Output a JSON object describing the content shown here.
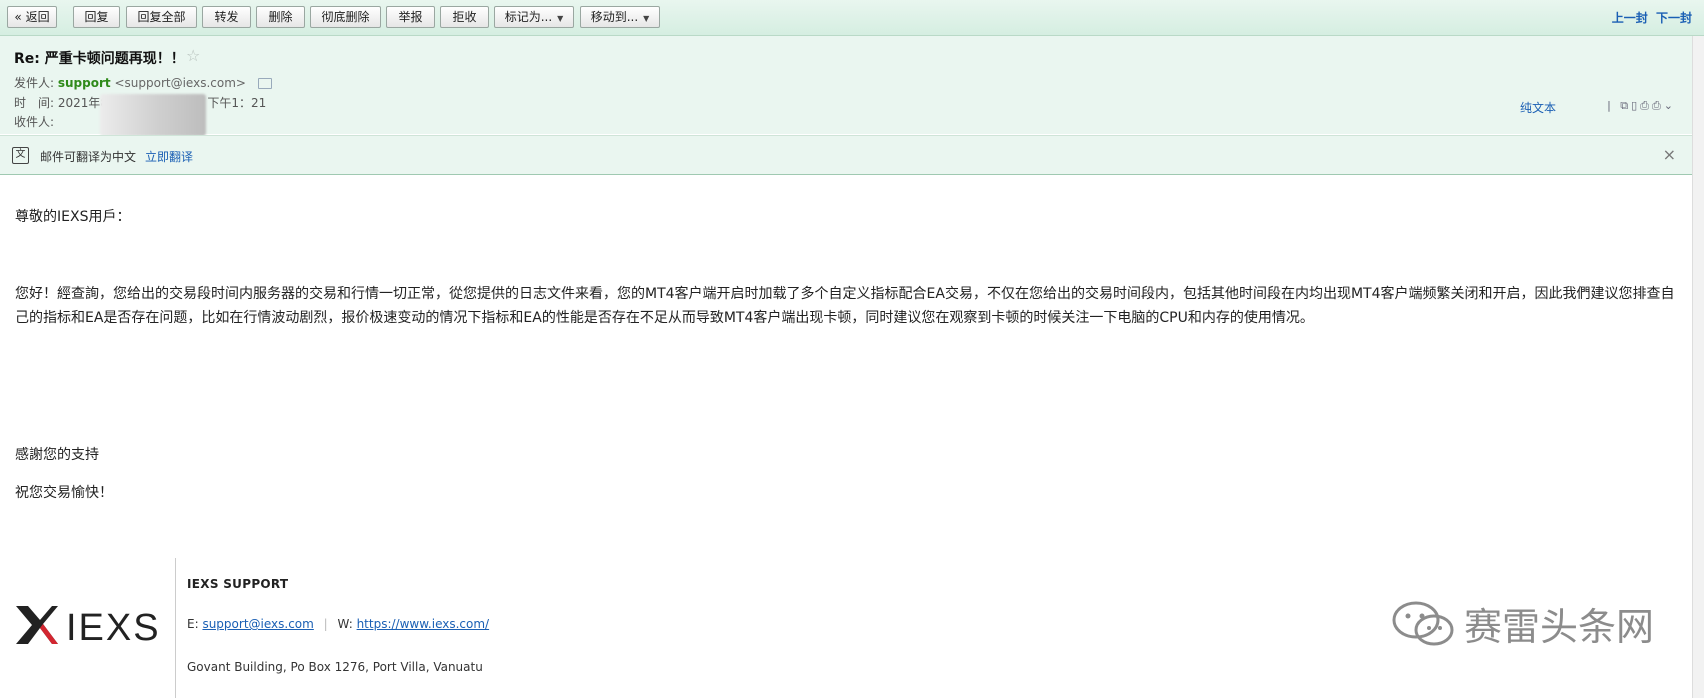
{
  "toolbar": {
    "back": "« 返回",
    "reply": "回复",
    "reply_all": "回复全部",
    "forward": "转发",
    "delete": "删除",
    "delete_forever": "彻底删除",
    "report": "举报",
    "reject": "拒收",
    "mark_as": "标记为...",
    "move_to": "移动到...",
    "prev": "上一封",
    "next": "下一封"
  },
  "header": {
    "subject": "Re: 严重卡顿问题再现！！",
    "sender_label": "发件人:",
    "sender_name": "support",
    "sender_email": "<support@iexs.com>",
    "time_label": "时　间:",
    "time_value": "2021年8月12日（星期四）下午1：21",
    "recipient_label": "收件人:",
    "plain_text": "纯文本",
    "star_icon": "star-icon"
  },
  "translate": {
    "notice": "邮件可翻译为中文",
    "action": "立即翻译"
  },
  "body": {
    "greeting": "尊敬的IEXS用戶：",
    "paragraph": "您好！經查詢，您给出的交易段时间内服务器的交易和行情一切正常，從您提供的日志文件来看，您的MT4客户端开启时加载了多个自定义指标配合EA交易，不仅在您给出的交易时间段内，包括其他时间段在内均出现MT4客户端频繁关闭和开启，因此我們建议您排查自己的指标和EA是否存在问题，比如在行情波动剧烈，报价极速变动的情况下指标和EA的性能是否存在不足从而导致MT4客户端出现卡顿，同时建议您在观察到卡顿的时候关注一下电脑的CPU和内存的使用情况。",
    "thanks": "感謝您的支持",
    "wish": "祝您交易愉快！"
  },
  "signature": {
    "logo_text": "IEXS",
    "title": "IEXS SUPPORT",
    "email_label": "E:",
    "email": "support@iexs.com",
    "web_label": "W:",
    "web": "https://www.iexs.com/",
    "address": "Govant Building, Po Box 1276, Port Villa, Vanuatu"
  },
  "watermark": {
    "text": "赛雷头条网"
  },
  "colors": {
    "toolbar_bg": "#d5eee1",
    "header_bg": "#eaf6f0",
    "link": "#1a5fb4",
    "sender": "#2f8a1a",
    "logo_red": "#d22630"
  }
}
